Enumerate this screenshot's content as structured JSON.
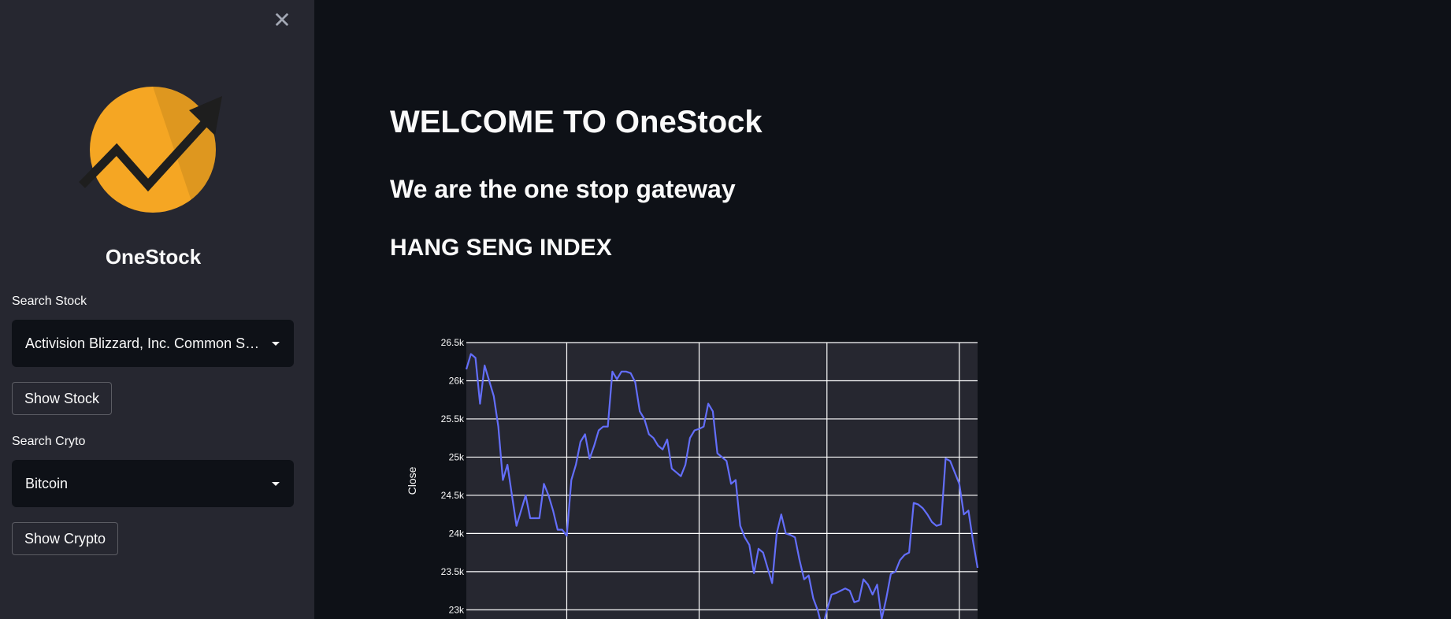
{
  "sidebar": {
    "close_symbol": "✕",
    "brand": "OneStock",
    "stock": {
      "label": "Search Stock",
      "selected": "Activision Blizzard, Inc. Common St…",
      "button": "Show Stock"
    },
    "crypto": {
      "label": "Search Cryto",
      "selected": "Bitcoin",
      "button": "Show Crypto"
    }
  },
  "main": {
    "title": "WELCOME TO OneStock",
    "subtitle": "We are the one stop gateway",
    "section": "HANG SENG INDEX"
  },
  "colors": {
    "logo_circle": "#f5a623",
    "logo_arrow": "#1e1e1e",
    "line": "#636efa"
  },
  "chart_data": {
    "type": "line",
    "title": "",
    "xlabel": "",
    "ylabel": "Close",
    "ylim": [
      22880,
      26500
    ],
    "y_ticks": [
      23000,
      23500,
      24000,
      24500,
      25000,
      25500,
      26000,
      26500
    ],
    "y_tick_labels": [
      "23k",
      "23.5k",
      "24k",
      "24.5k",
      "25k",
      "25.5k",
      "26k",
      "26.5k"
    ],
    "grid": true,
    "series": [
      {
        "name": "",
        "values": [
          26150,
          26350,
          26300,
          25700,
          26200,
          26000,
          25800,
          25400,
          24700,
          24900,
          24500,
          24100,
          24300,
          24500,
          24200,
          24200,
          24200,
          24650,
          24500,
          24300,
          24050,
          24050,
          23970,
          24700,
          24900,
          25200,
          25300,
          24980,
          25150,
          25350,
          25400,
          25400,
          26120,
          26020,
          26120,
          26120,
          26100,
          25980,
          25600,
          25500,
          25300,
          25250,
          25150,
          25100,
          25230,
          24850,
          24800,
          24750,
          24900,
          25250,
          25350,
          25370,
          25400,
          25700,
          25600,
          25050,
          25000,
          24950,
          24650,
          24700,
          24100,
          23950,
          23850,
          23480,
          23800,
          23750,
          23550,
          23350,
          24000,
          24250,
          24000,
          23980,
          23950,
          23650,
          23400,
          23450,
          23150,
          22990,
          22750,
          23000,
          23200,
          23220,
          23250,
          23280,
          23250,
          23100,
          23120,
          23400,
          23330,
          23200,
          23330,
          22880,
          23150,
          23470,
          23500,
          23650,
          23720,
          23750,
          24400,
          24380,
          24330,
          24250,
          24150,
          24100,
          24120,
          24980,
          24950,
          24800,
          24650,
          24250,
          24300,
          23900,
          23550
        ]
      }
    ]
  }
}
